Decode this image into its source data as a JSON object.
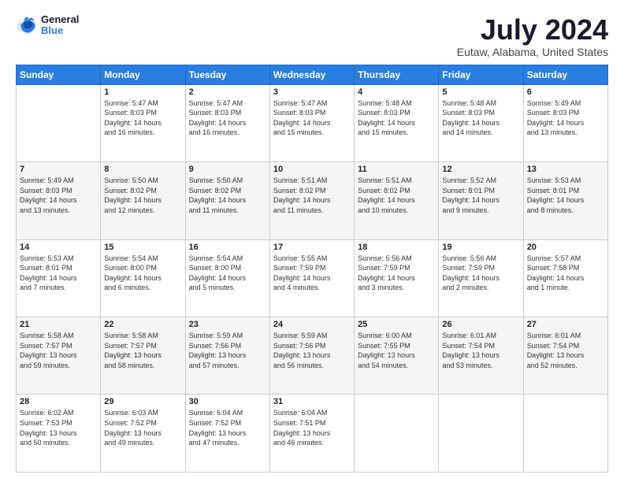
{
  "logo": {
    "line1": "General",
    "line2": "Blue"
  },
  "title": "July 2024",
  "subtitle": "Eutaw, Alabama, United States",
  "days_header": [
    "Sunday",
    "Monday",
    "Tuesday",
    "Wednesday",
    "Thursday",
    "Friday",
    "Saturday"
  ],
  "weeks": [
    [
      {
        "num": "",
        "info": ""
      },
      {
        "num": "1",
        "info": "Sunrise: 5:47 AM\nSunset: 8:03 PM\nDaylight: 14 hours\nand 16 minutes."
      },
      {
        "num": "2",
        "info": "Sunrise: 5:47 AM\nSunset: 8:03 PM\nDaylight: 14 hours\nand 16 minutes."
      },
      {
        "num": "3",
        "info": "Sunrise: 5:47 AM\nSunset: 8:03 PM\nDaylight: 14 hours\nand 15 minutes."
      },
      {
        "num": "4",
        "info": "Sunrise: 5:48 AM\nSunset: 8:03 PM\nDaylight: 14 hours\nand 15 minutes."
      },
      {
        "num": "5",
        "info": "Sunrise: 5:48 AM\nSunset: 8:03 PM\nDaylight: 14 hours\nand 14 minutes."
      },
      {
        "num": "6",
        "info": "Sunrise: 5:49 AM\nSunset: 8:03 PM\nDaylight: 14 hours\nand 13 minutes."
      }
    ],
    [
      {
        "num": "7",
        "info": "Sunrise: 5:49 AM\nSunset: 8:03 PM\nDaylight: 14 hours\nand 13 minutes."
      },
      {
        "num": "8",
        "info": "Sunrise: 5:50 AM\nSunset: 8:02 PM\nDaylight: 14 hours\nand 12 minutes."
      },
      {
        "num": "9",
        "info": "Sunrise: 5:50 AM\nSunset: 8:02 PM\nDaylight: 14 hours\nand 11 minutes."
      },
      {
        "num": "10",
        "info": "Sunrise: 5:51 AM\nSunset: 8:02 PM\nDaylight: 14 hours\nand 11 minutes."
      },
      {
        "num": "11",
        "info": "Sunrise: 5:51 AM\nSunset: 8:02 PM\nDaylight: 14 hours\nand 10 minutes."
      },
      {
        "num": "12",
        "info": "Sunrise: 5:52 AM\nSunset: 8:01 PM\nDaylight: 14 hours\nand 9 minutes."
      },
      {
        "num": "13",
        "info": "Sunrise: 5:53 AM\nSunset: 8:01 PM\nDaylight: 14 hours\nand 8 minutes."
      }
    ],
    [
      {
        "num": "14",
        "info": "Sunrise: 5:53 AM\nSunset: 8:01 PM\nDaylight: 14 hours\nand 7 minutes."
      },
      {
        "num": "15",
        "info": "Sunrise: 5:54 AM\nSunset: 8:00 PM\nDaylight: 14 hours\nand 6 minutes."
      },
      {
        "num": "16",
        "info": "Sunrise: 5:54 AM\nSunset: 8:00 PM\nDaylight: 14 hours\nand 5 minutes."
      },
      {
        "num": "17",
        "info": "Sunrise: 5:55 AM\nSunset: 7:59 PM\nDaylight: 14 hours\nand 4 minutes."
      },
      {
        "num": "18",
        "info": "Sunrise: 5:56 AM\nSunset: 7:59 PM\nDaylight: 14 hours\nand 3 minutes."
      },
      {
        "num": "19",
        "info": "Sunrise: 5:56 AM\nSunset: 7:59 PM\nDaylight: 14 hours\nand 2 minutes."
      },
      {
        "num": "20",
        "info": "Sunrise: 5:57 AM\nSunset: 7:58 PM\nDaylight: 14 hours\nand 1 minute."
      }
    ],
    [
      {
        "num": "21",
        "info": "Sunrise: 5:58 AM\nSunset: 7:57 PM\nDaylight: 13 hours\nand 59 minutes."
      },
      {
        "num": "22",
        "info": "Sunrise: 5:58 AM\nSunset: 7:57 PM\nDaylight: 13 hours\nand 58 minutes."
      },
      {
        "num": "23",
        "info": "Sunrise: 5:59 AM\nSunset: 7:56 PM\nDaylight: 13 hours\nand 57 minutes."
      },
      {
        "num": "24",
        "info": "Sunrise: 5:59 AM\nSunset: 7:56 PM\nDaylight: 13 hours\nand 56 minutes."
      },
      {
        "num": "25",
        "info": "Sunrise: 6:00 AM\nSunset: 7:55 PM\nDaylight: 13 hours\nand 54 minutes."
      },
      {
        "num": "26",
        "info": "Sunrise: 6:01 AM\nSunset: 7:54 PM\nDaylight: 13 hours\nand 53 minutes."
      },
      {
        "num": "27",
        "info": "Sunrise: 6:01 AM\nSunset: 7:54 PM\nDaylight: 13 hours\nand 52 minutes."
      }
    ],
    [
      {
        "num": "28",
        "info": "Sunrise: 6:02 AM\nSunset: 7:53 PM\nDaylight: 13 hours\nand 50 minutes."
      },
      {
        "num": "29",
        "info": "Sunrise: 6:03 AM\nSunset: 7:52 PM\nDaylight: 13 hours\nand 49 minutes."
      },
      {
        "num": "30",
        "info": "Sunrise: 6:04 AM\nSunset: 7:52 PM\nDaylight: 13 hours\nand 47 minutes."
      },
      {
        "num": "31",
        "info": "Sunrise: 6:04 AM\nSunset: 7:51 PM\nDaylight: 13 hours\nand 46 minutes."
      },
      {
        "num": "",
        "info": ""
      },
      {
        "num": "",
        "info": ""
      },
      {
        "num": "",
        "info": ""
      }
    ]
  ]
}
